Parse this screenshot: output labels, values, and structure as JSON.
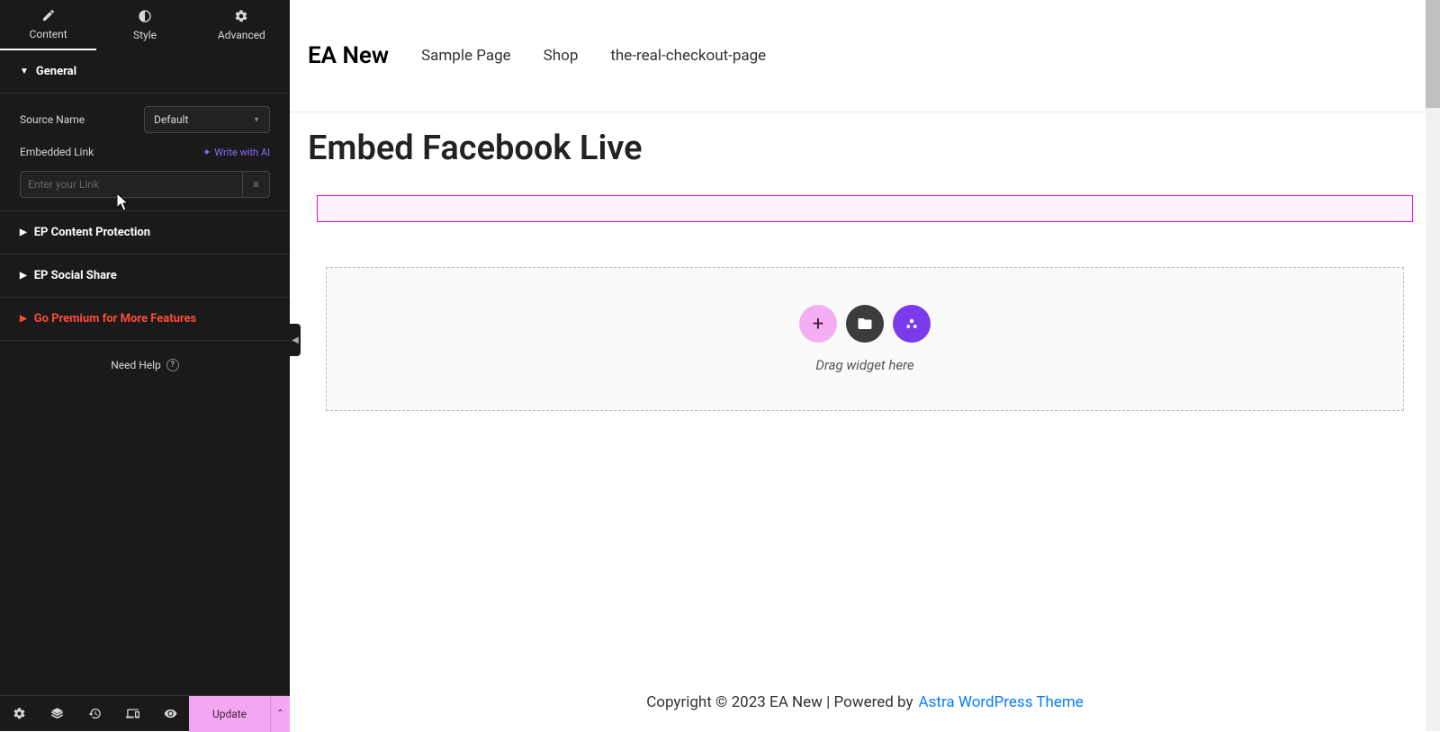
{
  "tabs": {
    "content": "Content",
    "style": "Style",
    "advanced": "Advanced"
  },
  "general": {
    "title": "General",
    "source_name_label": "Source Name",
    "source_name_value": "Default",
    "embedded_link_label": "Embedded Link",
    "write_ai": "Write with AI",
    "link_placeholder": "Enter your Link"
  },
  "sections": {
    "protection": "EP Content Protection",
    "social": "EP Social Share",
    "premium": "Go Premium for More Features"
  },
  "need_help": "Need Help",
  "footer": {
    "update": "Update"
  },
  "site": {
    "title": "EA New",
    "nav": [
      "Sample Page",
      "Shop",
      "the-real-checkout-page"
    ]
  },
  "page_title": "Embed Facebook Live",
  "dropzone": "Drag widget here",
  "copyright": "Copyright © 2023 EA New | Powered by",
  "theme_link": "Astra WordPress Theme"
}
